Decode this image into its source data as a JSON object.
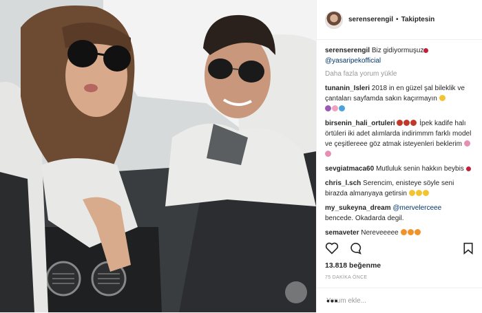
{
  "header": {
    "username": "serenserengil",
    "separator": "•",
    "follow_label": "Takiptesin"
  },
  "caption": {
    "username": "serenserengil",
    "text": "Biz gidiyormuşuz",
    "mention": "@yasaripekofficial"
  },
  "load_more_label": "Daha fazla yorum yükle",
  "comments": [
    {
      "username": "tunanin_Isleri",
      "text": "2018 in en güzel şal bileklik ve çantaları sayfamda sakın kaçırmayın"
    },
    {
      "username": "birsenin_hali_ortuleri",
      "text": "İpek kadife halı örtüleri iki adet alımlarda indirimmm farklı model ve çeşitlereee göz atmak isteyenleri beklerim"
    },
    {
      "username": "sevgiatmaca60",
      "text": "Mutluluk senin hakkın beybis"
    },
    {
      "username": "chris_l.sch",
      "text": "Serencim, enisteye söyle seni birazda almanyaya getirsin"
    },
    {
      "username": "my_sukeyna_dream",
      "mention": "@mervelerceee",
      "text": "bencede. Okadarda degil."
    },
    {
      "username": "semaveter",
      "text": "Nereveeeee"
    }
  ],
  "likes": {
    "count": "13.818",
    "label": "beğenme"
  },
  "timestamp": "75 DAKİKA ÖNCE",
  "add_comment_placeholder": "Yorum ekle...",
  "more_options": "•••",
  "icons": {
    "like": "heart-icon",
    "comment": "speech-bubble-icon",
    "save": "bookmark-icon"
  },
  "colors": {
    "link": "#003569",
    "muted": "#999999",
    "text": "#262626"
  }
}
